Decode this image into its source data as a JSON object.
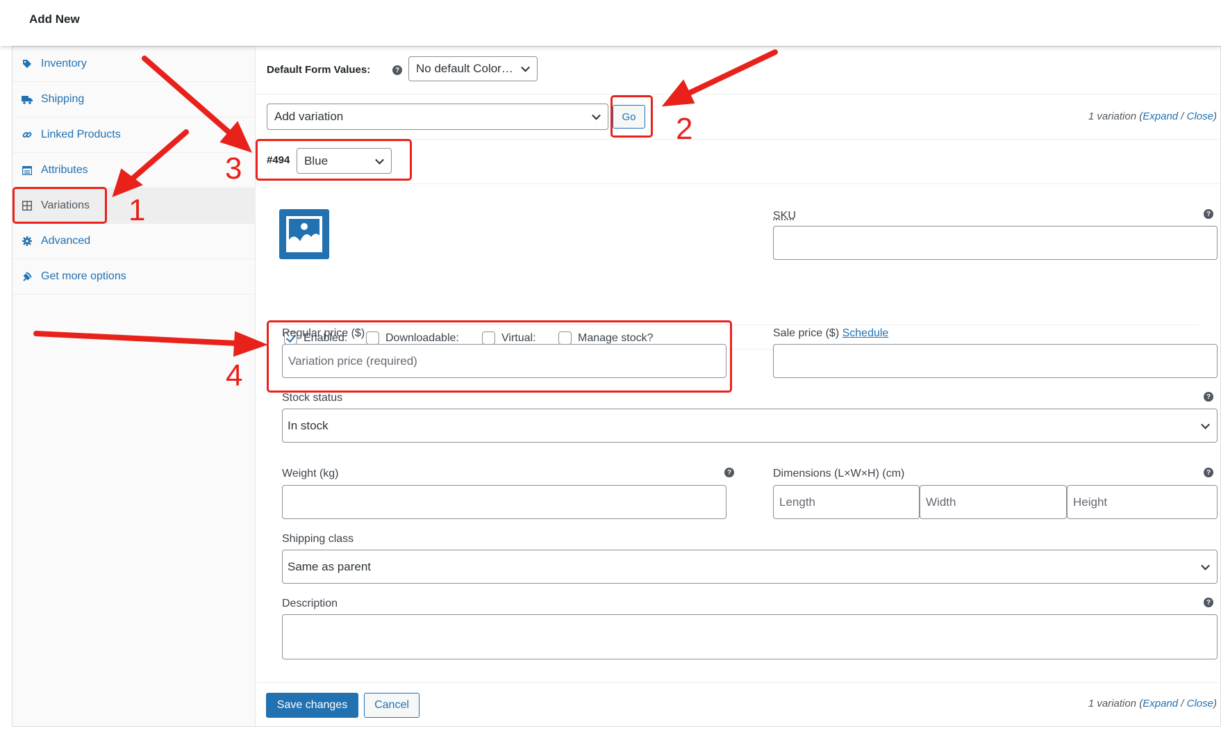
{
  "header": {
    "title": "Add New"
  },
  "sidebar": {
    "items": [
      {
        "label": "Inventory",
        "icon": "tag-icon"
      },
      {
        "label": "Shipping",
        "icon": "truck-icon"
      },
      {
        "label": "Linked Products",
        "icon": "link-icon"
      },
      {
        "label": "Attributes",
        "icon": "table-icon"
      },
      {
        "label": "Variations",
        "icon": "grid-icon",
        "active": true
      },
      {
        "label": "Advanced",
        "icon": "gear-icon"
      },
      {
        "label": "Get more options",
        "icon": "plugin-icon"
      }
    ]
  },
  "default_form": {
    "label": "Default Form Values:",
    "help": "?",
    "value": "No default Color…"
  },
  "actions": {
    "select_value": "Add variation",
    "go_label": "Go"
  },
  "variation_meta": {
    "count": "1 variation",
    "expand": "Expand",
    "sep": "/",
    "close": "Close",
    "open_paren": "(",
    "close_paren": ")"
  },
  "variation": {
    "id": "#494",
    "color": "Blue",
    "sku_label": "SKU",
    "checkboxes": [
      {
        "label": "Enabled:",
        "checked": true
      },
      {
        "label": "Downloadable:",
        "checked": false
      },
      {
        "label": "Virtual:",
        "checked": false
      },
      {
        "label": "Manage stock?",
        "checked": false
      }
    ],
    "regular_price_label": "Regular price ($)",
    "regular_price_placeholder": "Variation price (required)",
    "sale_price_label": "Sale price ($)",
    "sale_schedule": "Schedule",
    "stock_status_label": "Stock status",
    "stock_status_value": "In stock",
    "weight_label": "Weight (kg)",
    "dimensions_label": "Dimensions (L×W×H) (cm)",
    "length_ph": "Length",
    "width_ph": "Width",
    "height_ph": "Height",
    "shipping_class_label": "Shipping class",
    "shipping_class_value": "Same as parent",
    "description_label": "Description"
  },
  "footer": {
    "save_label": "Save changes",
    "cancel_label": "Cancel"
  },
  "annotations": {
    "n1": "1",
    "n2": "2",
    "n3": "3",
    "n4": "4",
    "color": "#e8221b"
  },
  "colors": {
    "accent": "#2271b1",
    "annotation": "#e8221b"
  }
}
